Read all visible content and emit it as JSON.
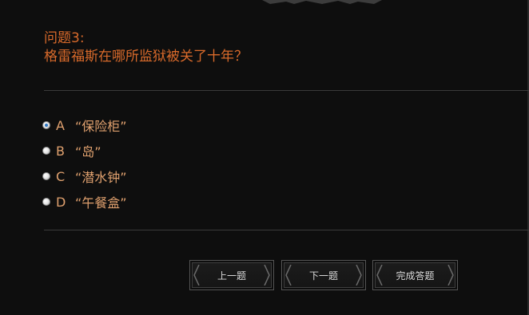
{
  "question": {
    "number_label": "问题3:",
    "text": "格雷福斯在哪所监狱被关了十年？"
  },
  "options": [
    {
      "letter": "A",
      "text": "“保险柜”",
      "selected": true
    },
    {
      "letter": "B",
      "text": "“岛”",
      "selected": false
    },
    {
      "letter": "C",
      "text": "“潜水钟”",
      "selected": false
    },
    {
      "letter": "D",
      "text": "“午餐盒”",
      "selected": false
    }
  ],
  "buttons": {
    "prev_label": "上一题",
    "next_label": "下一题",
    "finish_label": "完成答题"
  },
  "colors": {
    "question": "#d96a2b",
    "option_text": "#dfa06e",
    "radio_selected": "#2f78c4",
    "background": "#0e0e0e"
  }
}
